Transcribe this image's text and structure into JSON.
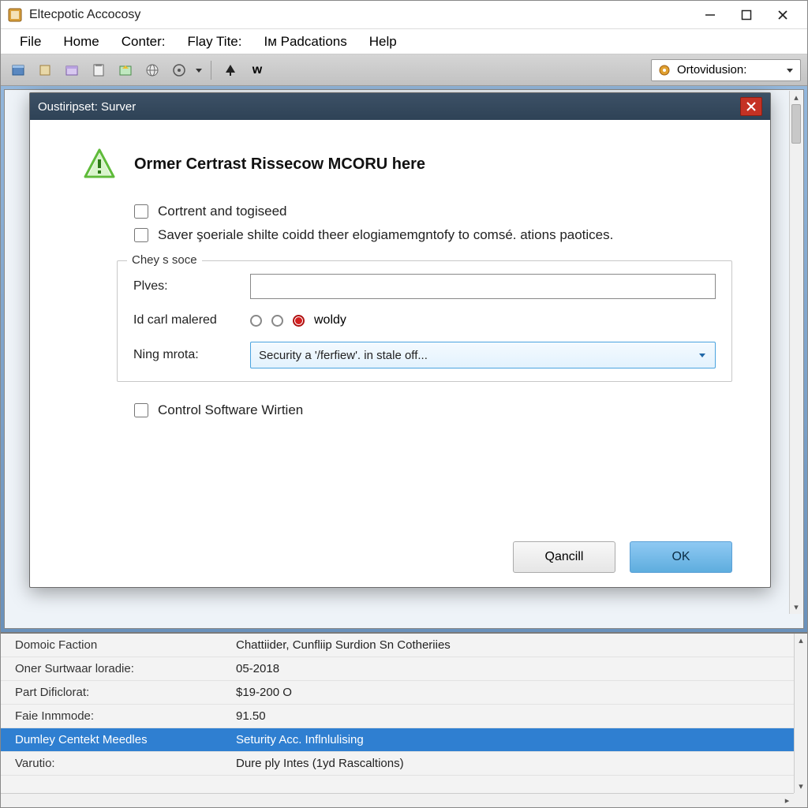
{
  "app": {
    "title": "Eltecpotic Accocosy"
  },
  "menu": {
    "file": "File",
    "home": "Home",
    "conter": "Conter:",
    "flay": "Flay Tite:",
    "pad": "Iм Padcations",
    "help": "Help"
  },
  "toolbar": {
    "combo_label": "Ortovidusion:"
  },
  "modal": {
    "title": "Oustiripset: Surver",
    "heading": "Ormer Certrast Rissecow MCORU here",
    "check1": "Cortrent and togiseed",
    "check2": "Saver şoeriale shilte coidd theer elogiamemgntofy to comsé. ations paotices.",
    "fieldset_legend": "Chey s soce",
    "label_plves": "Plves:",
    "plves_value": "",
    "label_idcarl": "Id carl malered",
    "radio_label": "woldy",
    "label_ning": "Ning mrota:",
    "select_value": "Security a '/ferfiew'. in stale off...",
    "check3": "Control Software Wirtien",
    "cancel": "Qancill",
    "ok": "OK"
  },
  "properties": [
    {
      "key": "Domoic Faction",
      "val": "Chattiider, Cunfliip Surdion Sn Cotheriies"
    },
    {
      "key": "Oner Surtwaar loradie:",
      "val": "05-2018"
    },
    {
      "key": "Part Dificlorat:",
      "val": "$19-200 O"
    },
    {
      "key": "Faie Inmmode:",
      "val": "91.50"
    },
    {
      "key": "Dumley Centekt Meedles",
      "val": "Seturity Acc. Inflnlulising",
      "selected": true
    },
    {
      "key": "Varutio:",
      "val": "Dure ply Intes (1yd Rascaltions)"
    }
  ]
}
